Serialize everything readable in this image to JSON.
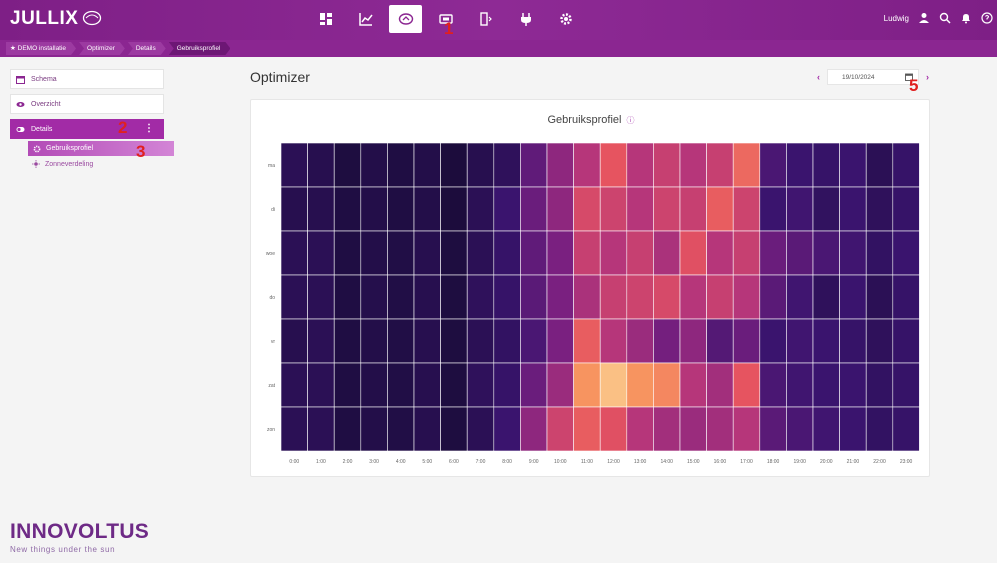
{
  "header": {
    "logo_text": "JULLIX",
    "user_name": "Ludwig",
    "nav_icons": [
      "dashboard-icon",
      "chart-icon",
      "optimizer-icon",
      "battery-icon",
      "meter-icon",
      "plug-icon",
      "settings-icon"
    ],
    "active_nav_index": 2
  },
  "breadcrumb": {
    "items": [
      "DEMO installatie",
      "Optimizer",
      "Details",
      "Gebruiksprofiel"
    ]
  },
  "sidebar": {
    "items": [
      {
        "label": "Schema",
        "icon": "calendar-icon"
      },
      {
        "label": "Overzicht",
        "icon": "eye-icon"
      },
      {
        "label": "Details",
        "icon": "toggle-icon",
        "active": true
      }
    ],
    "subitems": [
      {
        "label": "Gebruiksprofiel",
        "icon": "gear-icon",
        "active": true
      },
      {
        "label": "Zonneverdeling",
        "icon": "sun-icon",
        "active": false
      }
    ]
  },
  "annotations": [
    "1",
    "2",
    "3",
    "5"
  ],
  "main": {
    "title": "Optimizer",
    "date": "19/10/2024"
  },
  "footer": {
    "brand": "INNOVOLTUS",
    "tagline": "New things under the sun"
  },
  "chart_data": {
    "type": "heatmap",
    "title": "Gebruiksprofiel",
    "x_labels": [
      "0:00",
      "1:00",
      "2:00",
      "3:00",
      "4:00",
      "5:00",
      "6:00",
      "7:00",
      "8:00",
      "9:00",
      "10:00",
      "11:00",
      "12:00",
      "13:00",
      "14:00",
      "15:00",
      "16:00",
      "17:00",
      "18:00",
      "19:00",
      "20:00",
      "21:00",
      "22:00",
      "23:00"
    ],
    "y_labels": [
      "ma",
      "di",
      "woe",
      "do",
      "vr",
      "zat",
      "zon"
    ],
    "grid": true,
    "values": [
      [
        0.12,
        0.1,
        0.05,
        0.08,
        0.06,
        0.08,
        0.04,
        0.1,
        0.14,
        0.32,
        0.45,
        0.55,
        0.7,
        0.55,
        0.6,
        0.55,
        0.6,
        0.75,
        0.25,
        0.2,
        0.18,
        0.2,
        0.12,
        0.18
      ],
      [
        0.1,
        0.1,
        0.06,
        0.08,
        0.06,
        0.08,
        0.04,
        0.12,
        0.2,
        0.35,
        0.45,
        0.65,
        0.62,
        0.55,
        0.62,
        0.6,
        0.72,
        0.62,
        0.2,
        0.22,
        0.15,
        0.2,
        0.14,
        0.18
      ],
      [
        0.12,
        0.12,
        0.06,
        0.08,
        0.07,
        0.1,
        0.05,
        0.12,
        0.18,
        0.32,
        0.4,
        0.6,
        0.55,
        0.6,
        0.52,
        0.68,
        0.55,
        0.6,
        0.35,
        0.3,
        0.25,
        0.22,
        0.16,
        0.2
      ],
      [
        0.12,
        0.12,
        0.06,
        0.09,
        0.07,
        0.1,
        0.05,
        0.14,
        0.18,
        0.3,
        0.4,
        0.52,
        0.6,
        0.62,
        0.65,
        0.55,
        0.6,
        0.55,
        0.3,
        0.22,
        0.14,
        0.2,
        0.12,
        0.18
      ],
      [
        0.1,
        0.12,
        0.06,
        0.08,
        0.07,
        0.1,
        0.05,
        0.12,
        0.16,
        0.25,
        0.4,
        0.72,
        0.55,
        0.48,
        0.38,
        0.45,
        0.28,
        0.35,
        0.2,
        0.22,
        0.2,
        0.18,
        0.14,
        0.18
      ],
      [
        0.12,
        0.12,
        0.06,
        0.08,
        0.07,
        0.1,
        0.05,
        0.14,
        0.18,
        0.35,
        0.48,
        0.85,
        0.95,
        0.85,
        0.82,
        0.55,
        0.5,
        0.7,
        0.25,
        0.22,
        0.2,
        0.2,
        0.16,
        0.18
      ],
      [
        0.12,
        0.12,
        0.06,
        0.08,
        0.07,
        0.1,
        0.05,
        0.12,
        0.2,
        0.45,
        0.62,
        0.72,
        0.68,
        0.55,
        0.5,
        0.48,
        0.5,
        0.55,
        0.3,
        0.25,
        0.22,
        0.2,
        0.16,
        0.18
      ]
    ]
  }
}
